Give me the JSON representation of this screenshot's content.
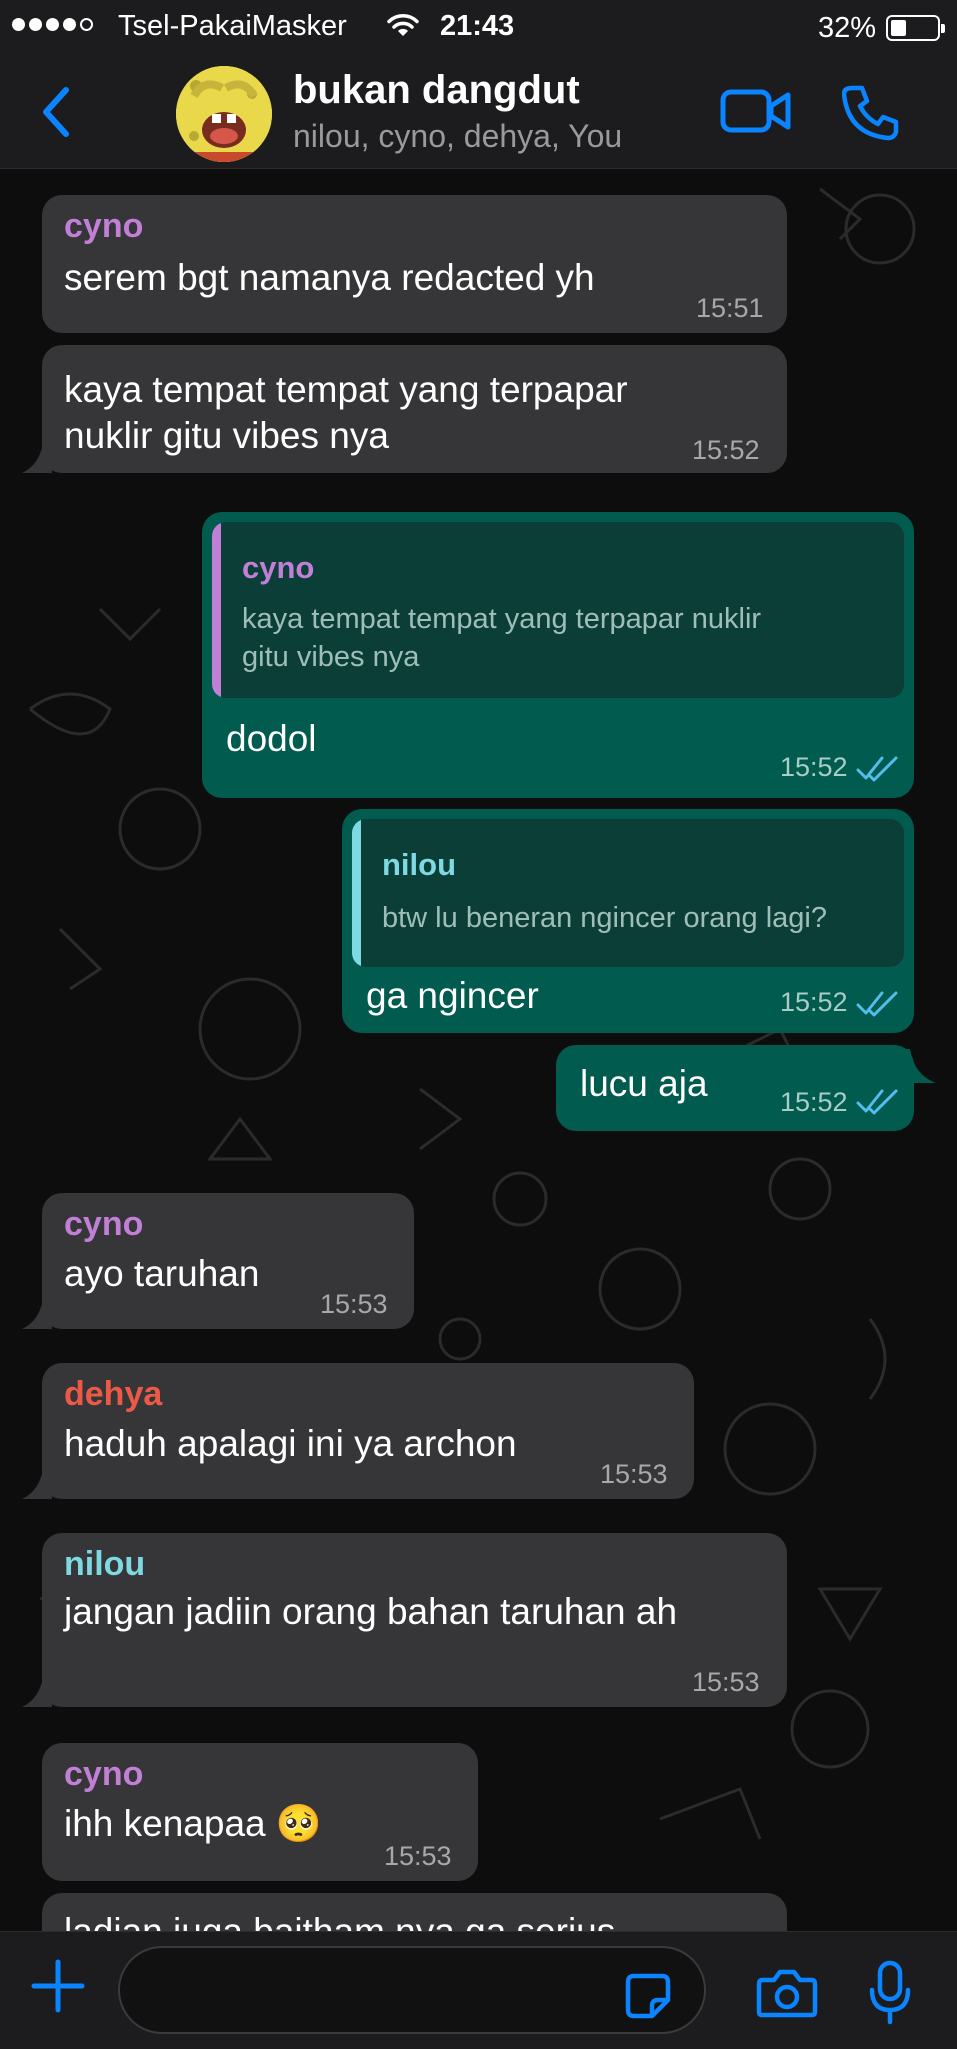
{
  "status_bar": {
    "carrier": "Tsel-PakaiMasker",
    "time": "21:43",
    "battery_percent": "32%",
    "battery_level": 0.32,
    "signal_bars_filled": 4,
    "signal_bars_total": 5
  },
  "header": {
    "title": "bukan dangdut",
    "subtitle": "nilou, cyno, dehya, You",
    "accent_color": "#0a84ff"
  },
  "sender_colors": {
    "cyno": "#c17fd6",
    "dehya": "#ec5a47",
    "nilou": "#7fd9e3"
  },
  "messages": [
    {
      "direction": "in",
      "sender": "cyno",
      "text": "serem bgt namanya redacted yh",
      "time": "15:51"
    },
    {
      "direction": "in",
      "sender": "",
      "text_lines": [
        "kaya tempat tempat yang terpapar",
        "nuklir gitu vibes nya"
      ],
      "time": "15:52"
    },
    {
      "direction": "out",
      "quote": {
        "name": "cyno",
        "text_lines": [
          "kaya tempat tempat yang terpapar nuklir",
          "gitu vibes nya"
        ]
      },
      "text": "dodol",
      "time": "15:52",
      "status": "read"
    },
    {
      "direction": "out",
      "quote": {
        "name": "nilou",
        "text": "btw lu beneran ngincer orang lagi?"
      },
      "text": "ga ngincer",
      "time": "15:52",
      "status": "read"
    },
    {
      "direction": "out",
      "text": "lucu aja",
      "time": "15:52",
      "status": "read"
    },
    {
      "direction": "in",
      "sender": "cyno",
      "text": "ayo taruhan",
      "time": "15:53"
    },
    {
      "direction": "in",
      "sender": "dehya",
      "text": "haduh apalagi ini ya archon",
      "time": "15:53"
    },
    {
      "direction": "in",
      "sender": "nilou",
      "text": "jangan jadiin orang bahan taruhan ah",
      "time": "15:53"
    },
    {
      "direction": "in",
      "sender": "cyno",
      "text": "ihh kenapaa 🥺",
      "time": "15:53"
    },
    {
      "direction": "in",
      "sender": "",
      "text": "ladian juga baitham nya ga serius",
      "time": "",
      "partially_hidden": true
    }
  ],
  "input": {
    "placeholder": ""
  }
}
